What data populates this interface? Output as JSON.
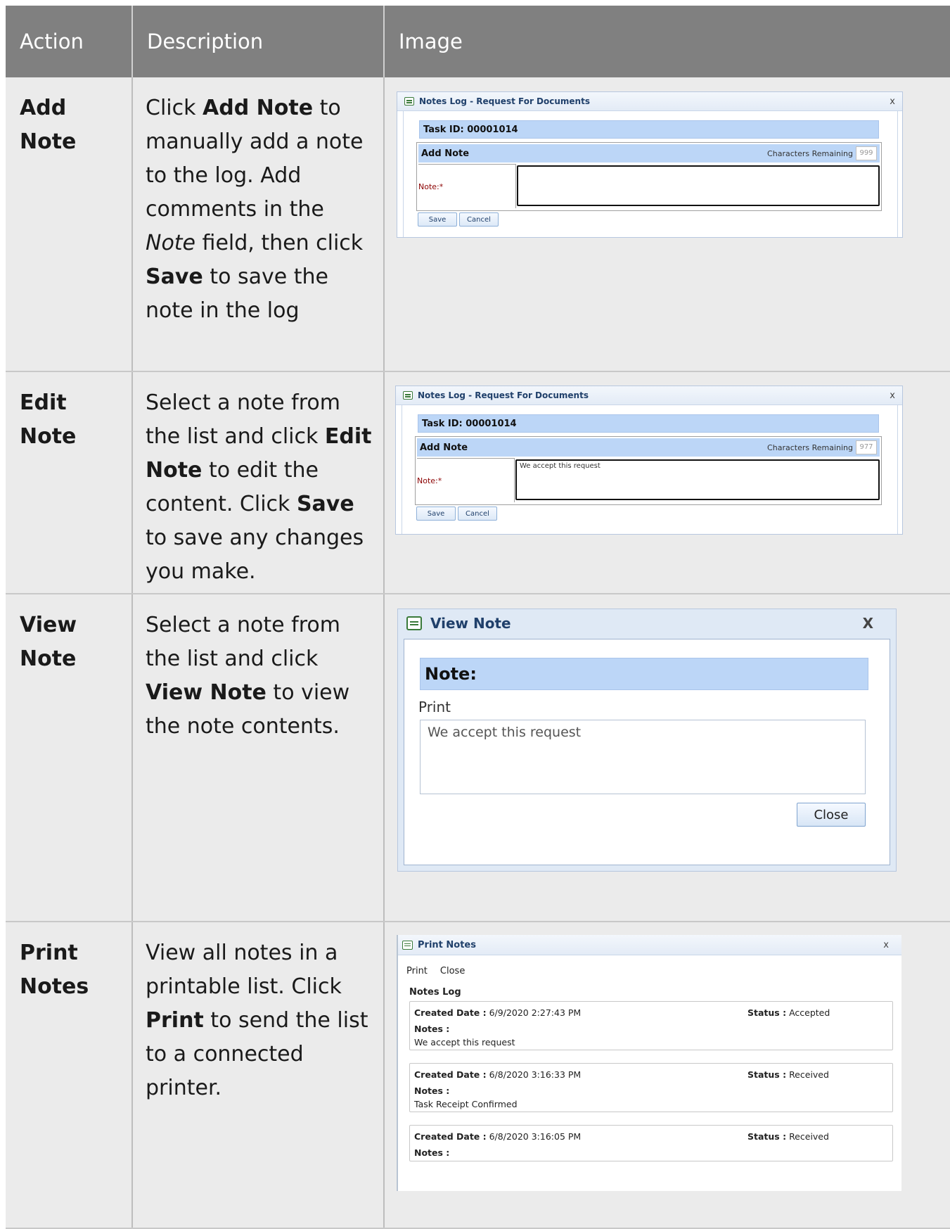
{
  "table": {
    "headers": [
      "Action",
      "Description",
      "Image"
    ],
    "rows": [
      {
        "action": "Add Note",
        "desc_parts": [
          {
            "t": "Click "
          },
          {
            "b": "Add Note"
          },
          {
            "t": " to manually add a note to the log. Add comments in the "
          },
          {
            "i": "Note"
          },
          {
            "t": " field, then click "
          },
          {
            "b": "Save"
          },
          {
            "t": " to save the note in the log"
          }
        ]
      },
      {
        "action": "Edit Note",
        "desc_parts": [
          {
            "t": "Select a note from the list and click "
          },
          {
            "b": "Edit Note"
          },
          {
            "t": " to edit the content. Click "
          },
          {
            "b": "Save"
          },
          {
            "t": " to save any changes you make."
          }
        ]
      },
      {
        "action": "View Note",
        "desc_parts": [
          {
            "t": "Select a note from the list and click "
          },
          {
            "b": "View Note"
          },
          {
            "t": " to view the note contents."
          }
        ]
      },
      {
        "action": "Print Notes",
        "desc_parts": [
          {
            "t": "View all notes in a printable list. Click "
          },
          {
            "b": "Print"
          },
          {
            "t": " to send the list to a connected printer."
          }
        ]
      }
    ]
  },
  "notes_log": {
    "title": "Notes Log - Request For Documents",
    "close_glyph": "x",
    "task_id": "Task ID: 00001014",
    "add_note_label": "Add Note",
    "chars_label": "Characters Remaining",
    "note_label": "Note:*",
    "save_label": "Save",
    "cancel_label": "Cancel",
    "add": {
      "chars_remaining": "999",
      "note_value": ""
    },
    "edit": {
      "chars_remaining": "977",
      "note_value": "We accept this request"
    }
  },
  "view_note": {
    "title": "View Note",
    "close_glyph": "X",
    "heading": "Note:",
    "print_link": "Print",
    "note_text": "We accept this request",
    "close_label": "Close"
  },
  "print_notes": {
    "title": "Print Notes",
    "close_glyph": "x",
    "menu": [
      "Print",
      "Close"
    ],
    "log_title": "Notes Log",
    "created_label": "Created Date :",
    "status_label": "Status :",
    "notes_label": "Notes :",
    "entries": [
      {
        "created": "6/9/2020 2:27:43 PM",
        "status": "Accepted",
        "note": "We accept this request"
      },
      {
        "created": "6/8/2020 3:16:33 PM",
        "status": "Received",
        "note": "Task Receipt Confirmed"
      },
      {
        "created": "6/8/2020 3:16:05 PM",
        "status": "Received",
        "note": ""
      }
    ]
  }
}
